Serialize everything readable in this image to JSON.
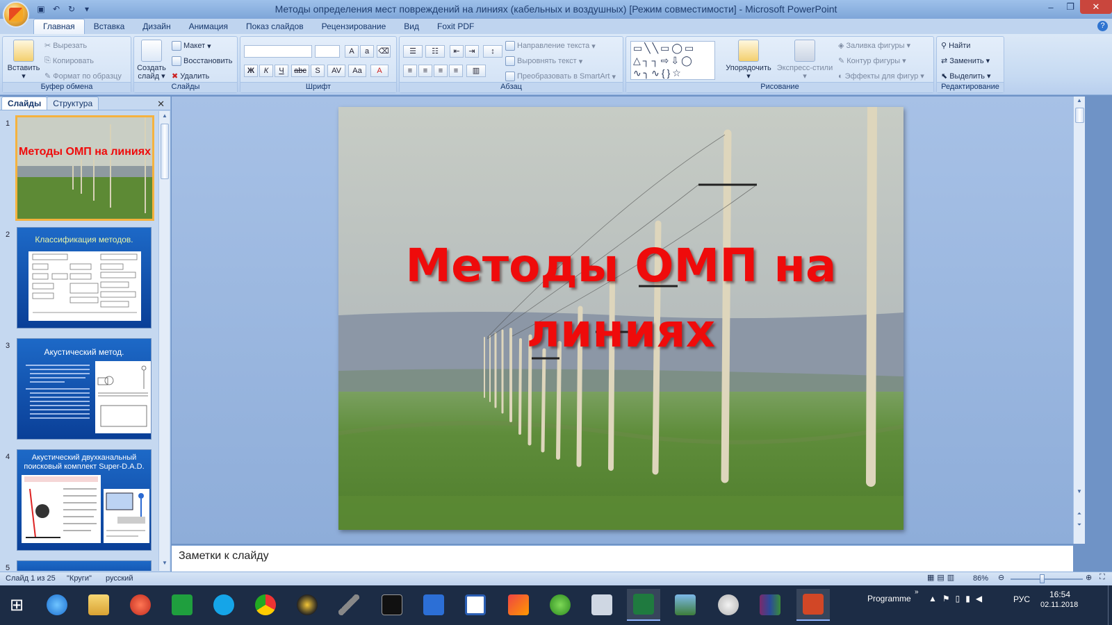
{
  "window": {
    "title": "Методы определения мест повреждений на линиях (кабельных и воздушных) [Режим совместимости] - Microsoft PowerPoint"
  },
  "tabs": [
    "Главная",
    "Вставка",
    "Дизайн",
    "Анимация",
    "Показ слайдов",
    "Рецензирование",
    "Вид",
    "Foxit PDF"
  ],
  "ribbon": {
    "clipboard": {
      "name": "Буфер обмена",
      "paste": "Вставить",
      "cut": "Вырезать",
      "copy": "Копировать",
      "format": "Формат по образцу"
    },
    "slides": {
      "name": "Слайды",
      "new_slide": "Создать слайд",
      "layout": "Макет",
      "reset": "Восстановить",
      "delete": "Удалить"
    },
    "font": {
      "name": "Шрифт"
    },
    "paragraph": {
      "name": "Абзац",
      "direction": "Направление текста",
      "align": "Выровнять текст",
      "smartart": "Преобразовать в SmartArt"
    },
    "drawing": {
      "name": "Рисование",
      "arrange": "Упорядочить",
      "styles": "Экспресс-стили",
      "fill": "Заливка фигуры",
      "outline": "Контур фигуры",
      "effects": "Эффекты для фигур"
    },
    "editing": {
      "name": "Редактирование",
      "find": "Найти",
      "replace": "Заменить",
      "select": "Выделить"
    }
  },
  "panel": {
    "tab_slides": "Слайды",
    "tab_outline": "Структура",
    "thumbs": [
      {
        "num": "1",
        "title": "Методы ОМП на линиях"
      },
      {
        "num": "2",
        "title": "Классификация методов."
      },
      {
        "num": "3",
        "title": "Акустический метод."
      },
      {
        "num": "4",
        "title": "Акустический двухканальный поисковый комплект Super-D.A.D."
      },
      {
        "num": "5",
        "title": ""
      }
    ]
  },
  "slide": {
    "title": "Методы ОМП на линиях"
  },
  "notes": {
    "placeholder": "Заметки к слайду"
  },
  "status": {
    "slide": "Слайд 1 из 25",
    "theme": "\"Круги\"",
    "lang": "русский",
    "zoom": "86%",
    "zoom_fraction": 0.43
  },
  "taskbar": {
    "programme": "Programme",
    "lang": "РУС",
    "time": "16:54",
    "date": "02.11.2018"
  }
}
